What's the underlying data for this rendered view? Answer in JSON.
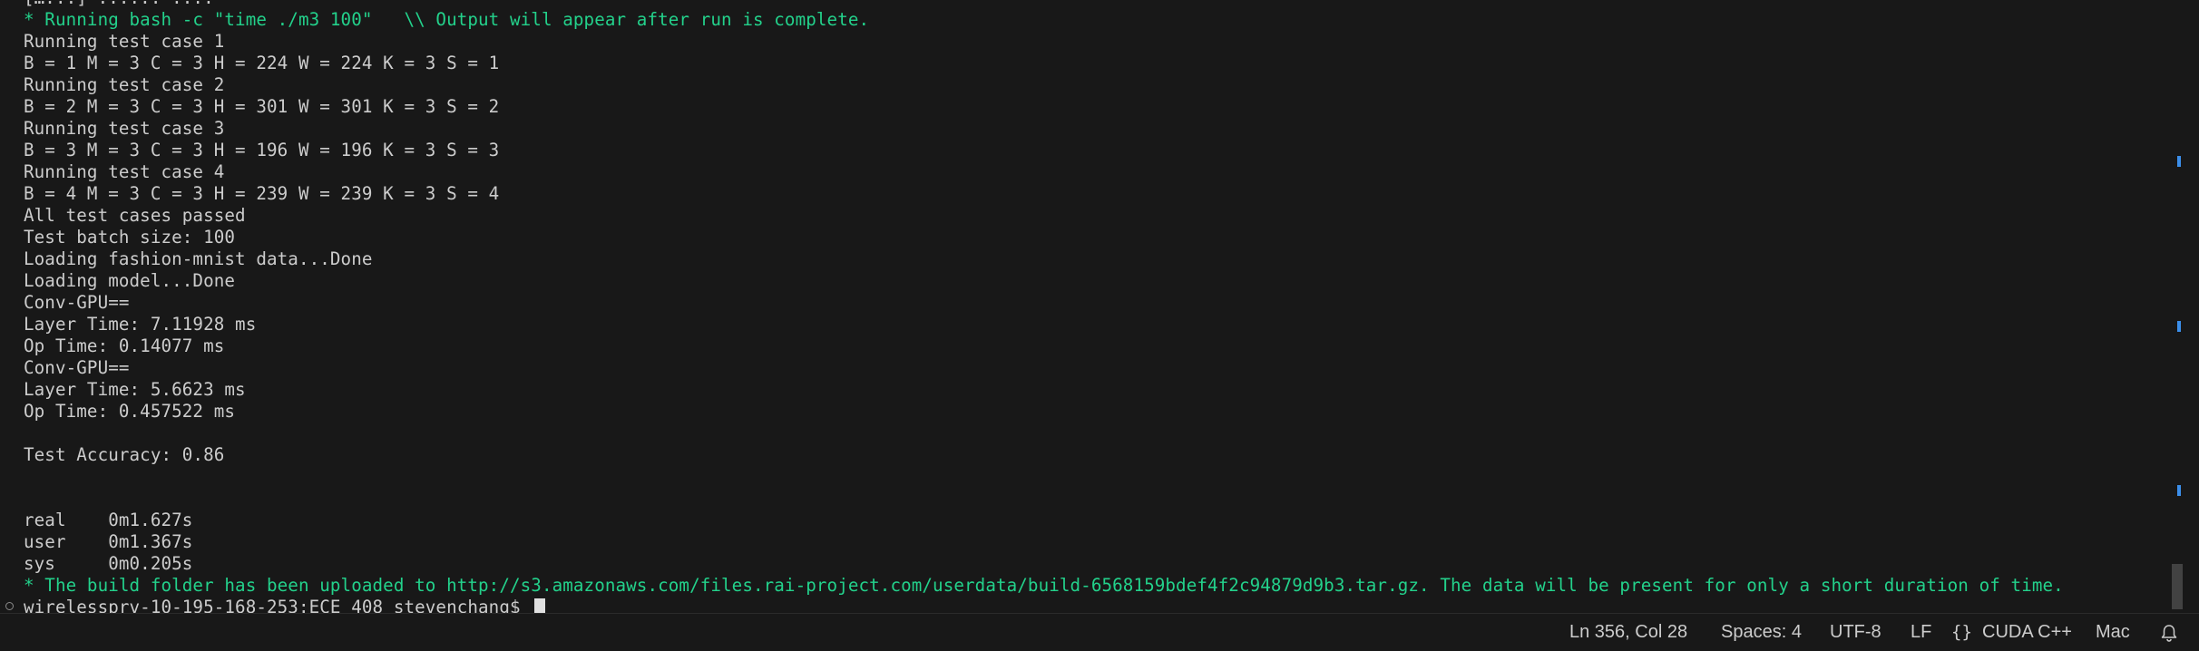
{
  "terminal": {
    "lines": [
      {
        "text": "[…...] ...... ....",
        "color": "default"
      },
      {
        "text": "* Running bash -c \"time ./m3 100\"   \\\\ Output will appear after run is complete.",
        "color": "green"
      },
      {
        "text": "Running test case 1",
        "color": "default"
      },
      {
        "text": "B = 1 M = 3 C = 3 H = 224 W = 224 K = 3 S = 1",
        "color": "default"
      },
      {
        "text": "Running test case 2",
        "color": "default"
      },
      {
        "text": "B = 2 M = 3 C = 3 H = 301 W = 301 K = 3 S = 2",
        "color": "default"
      },
      {
        "text": "Running test case 3",
        "color": "default"
      },
      {
        "text": "B = 3 M = 3 C = 3 H = 196 W = 196 K = 3 S = 3",
        "color": "default"
      },
      {
        "text": "Running test case 4",
        "color": "default"
      },
      {
        "text": "B = 4 M = 3 C = 3 H = 239 W = 239 K = 3 S = 4",
        "color": "default"
      },
      {
        "text": "All test cases passed",
        "color": "default"
      },
      {
        "text": "Test batch size: 100",
        "color": "default"
      },
      {
        "text": "Loading fashion-mnist data...Done",
        "color": "default"
      },
      {
        "text": "Loading model...Done",
        "color": "default"
      },
      {
        "text": "Conv-GPU==",
        "color": "default"
      },
      {
        "text": "Layer Time: 7.11928 ms",
        "color": "default"
      },
      {
        "text": "Op Time: 0.14077 ms",
        "color": "default"
      },
      {
        "text": "Conv-GPU==",
        "color": "default"
      },
      {
        "text": "Layer Time: 5.6623 ms",
        "color": "default"
      },
      {
        "text": "Op Time: 0.457522 ms",
        "color": "default"
      },
      {
        "text": "",
        "color": "default"
      },
      {
        "text": "Test Accuracy: 0.86",
        "color": "default"
      },
      {
        "text": "",
        "color": "default"
      },
      {
        "text": "",
        "color": "default"
      },
      {
        "text": "real    0m1.627s",
        "color": "default"
      },
      {
        "text": "user    0m1.367s",
        "color": "default"
      },
      {
        "text": "sys     0m0.205s",
        "color": "default"
      },
      {
        "text": "* The build folder has been uploaded to http://s3.amazonaws.com/files.rai-project.com/userdata/build-6568159bdef4f2c94879d9b3.tar.gz. The data will be present for only a short duration of time.",
        "color": "green"
      }
    ],
    "prompt": "wirelessprv-10-195-168-253:ECE 408 stevenchang$ ",
    "colors": {
      "background": "#181818",
      "text": "#cccccc",
      "green": "#23d18b",
      "scroll_marker": "#3b8eea"
    }
  },
  "statusbar": {
    "position": "Ln 356, Col 28",
    "spaces": "Spaces: 4",
    "encoding": "UTF-8",
    "eol": "LF",
    "language_icon": "braces-icon",
    "language": "CUDA C++",
    "platform": "Mac",
    "notification_icon": "bell-icon"
  }
}
